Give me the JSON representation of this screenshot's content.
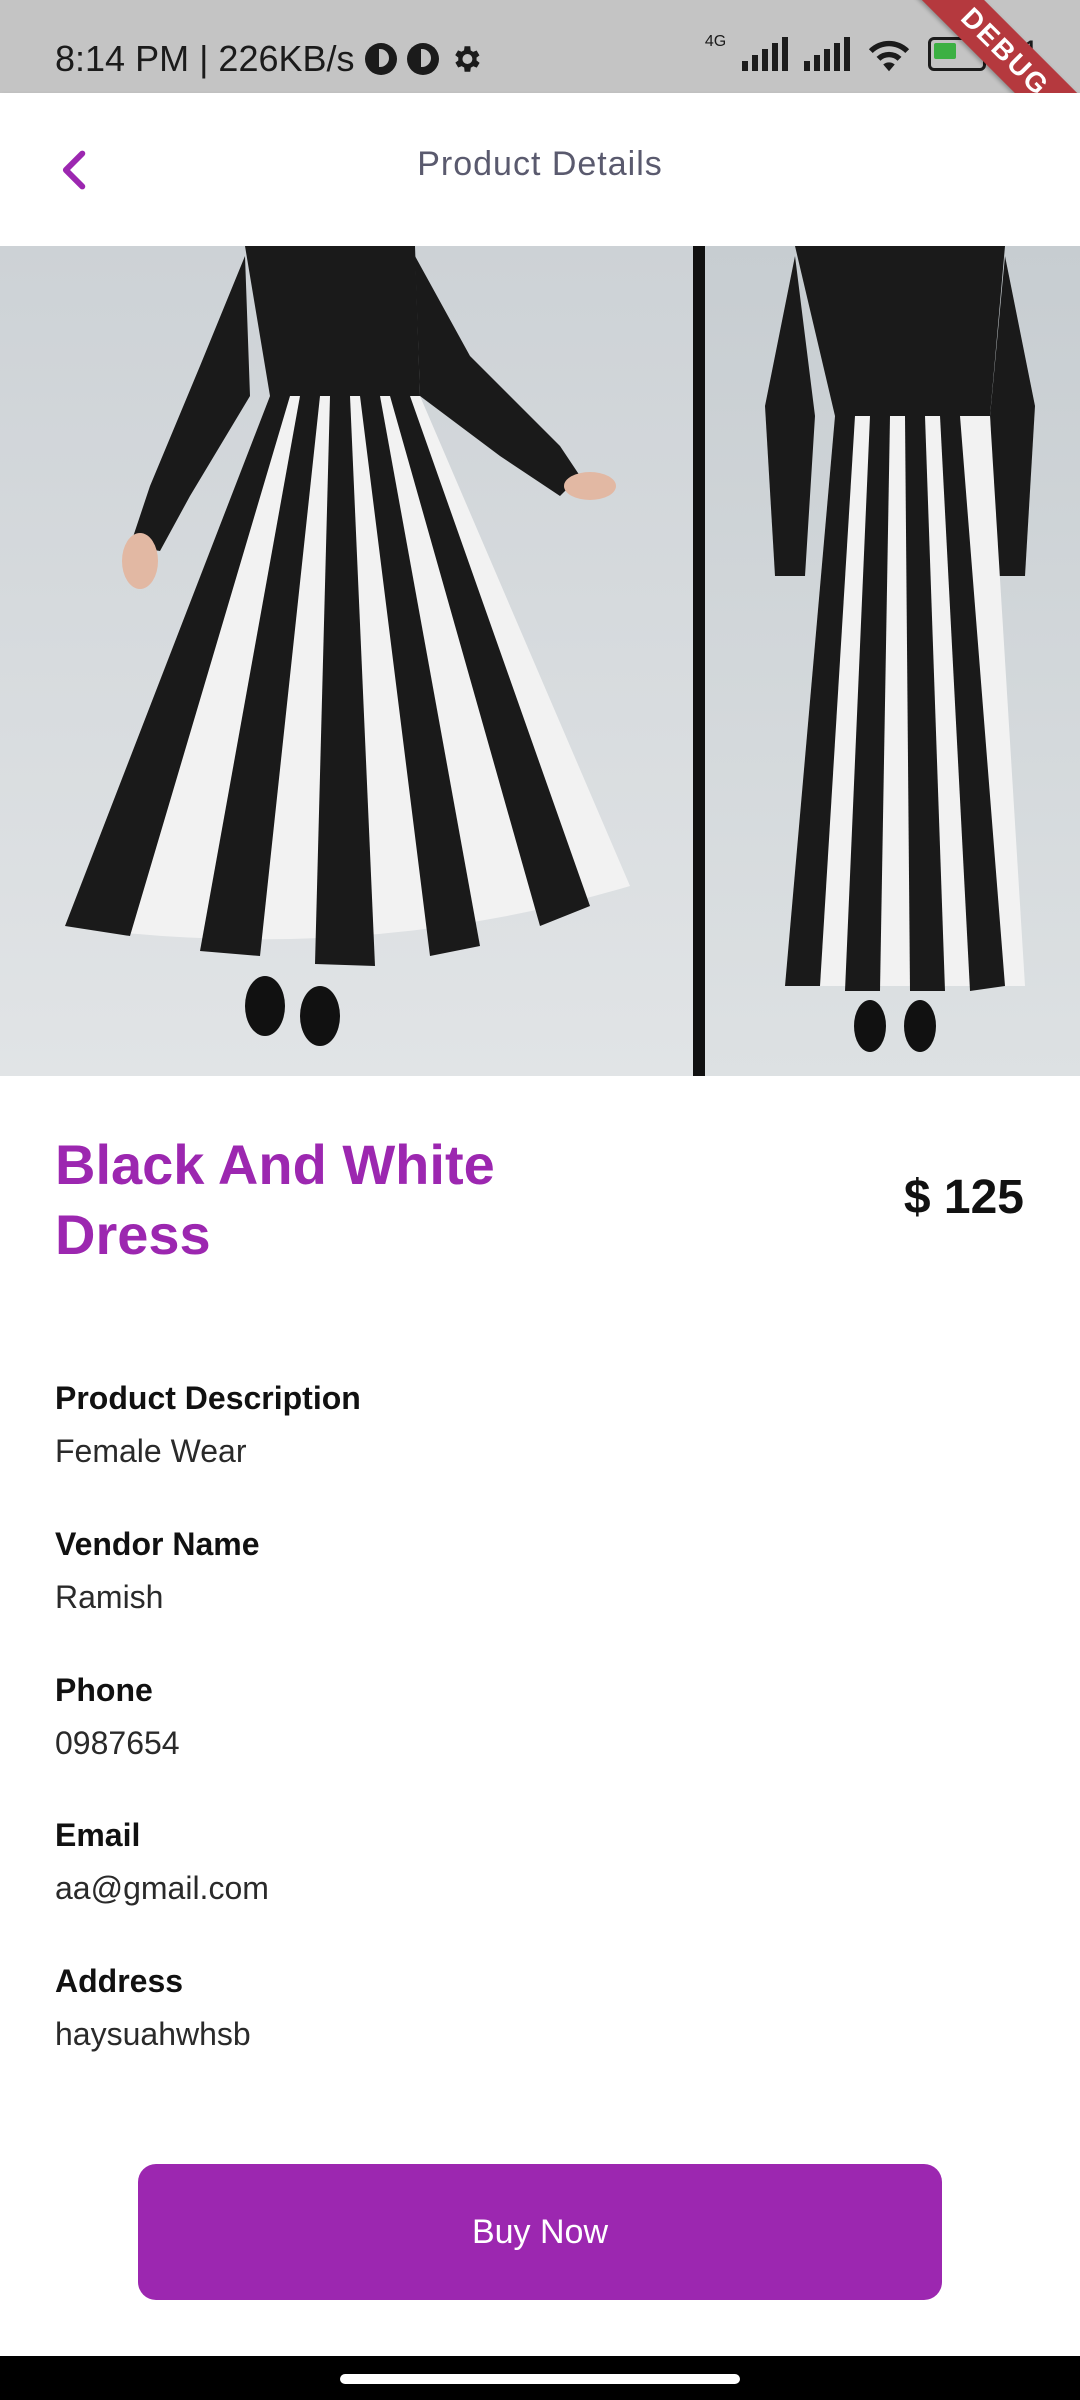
{
  "status_bar": {
    "time_speed": "8:14 PM | 226KB/s",
    "network_type": "4G",
    "battery_percent": "51",
    "icons": [
      "circle-app-icon",
      "circle-app-icon",
      "gear-icon",
      "signal-icon",
      "signal-icon",
      "wifi-icon",
      "battery-icon"
    ]
  },
  "debug_banner": "DEBUG",
  "app_bar": {
    "title": "Product Details",
    "back_icon": "chevron-left-icon"
  },
  "product": {
    "title": "Black And White Dress",
    "price": "$ 125"
  },
  "details": {
    "description_label": "Product Description",
    "description_value": "Female Wear",
    "vendor_label": "Vendor Name",
    "vendor_value": "Ramish",
    "phone_label": "Phone",
    "phone_value": "0987654",
    "email_label": "Email",
    "email_value": "aa@gmail.com",
    "address_label": "Address",
    "address_value": "haysuahwhsb"
  },
  "actions": {
    "buy_label": "Buy Now"
  },
  "colors": {
    "accent": "#9c27b0",
    "status_bar_bg": "#c4c4c4",
    "debug_banner": "#b5393e"
  }
}
